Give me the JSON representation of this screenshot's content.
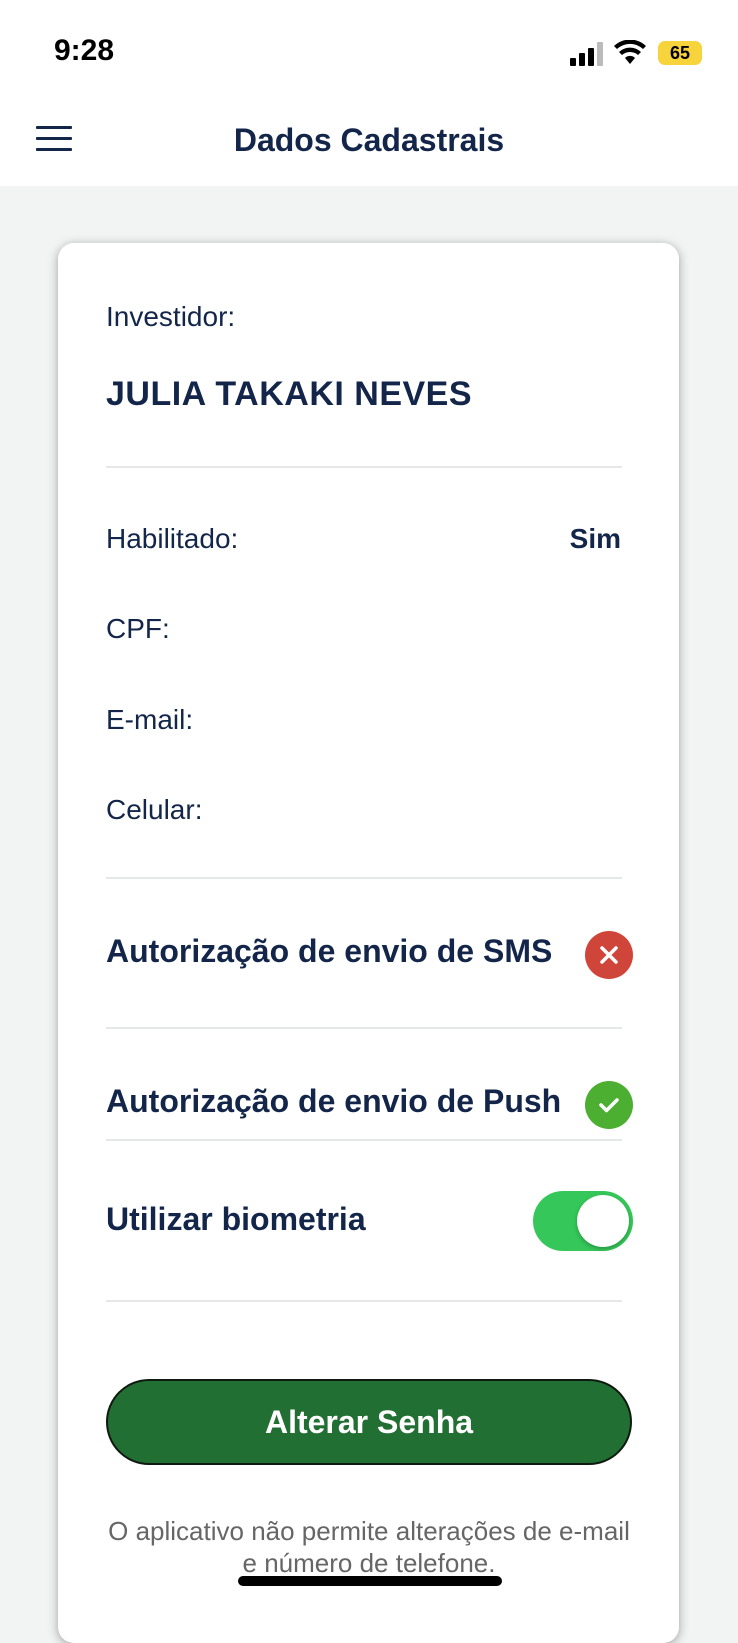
{
  "status_bar": {
    "time": "9:28",
    "battery_level": "65",
    "icons": [
      "signal-icon",
      "wifi-icon",
      "battery-charging-icon"
    ]
  },
  "header": {
    "title": "Dados Cadastrais",
    "menu_icon": "hamburger-menu-icon"
  },
  "investor": {
    "label": "Investidor:",
    "name": "JULIA TAKAKI NEVES"
  },
  "details": {
    "habilitado_label": "Habilitado:",
    "habilitado_value": "Sim",
    "cpf_label": "CPF:",
    "email_label": "E-mail:",
    "celular_label": "Celular:"
  },
  "authorizations": {
    "sms_label": "Autorização de envio de SMS",
    "sms_status": "disabled",
    "push_label": "Autorização de envio de Push",
    "push_status": "enabled"
  },
  "biometrics": {
    "label": "Utilizar biometria",
    "enabled": true
  },
  "actions": {
    "change_password_label": "Alterar Senha"
  },
  "disclaimer": "O aplicativo não permite alterações de e-mail e número de telefone.",
  "colors": {
    "primary_text": "#13264a",
    "button_green": "#226f33",
    "toggle_green": "#35c759",
    "error_red": "#d0453a",
    "success_green": "#4caf32"
  }
}
